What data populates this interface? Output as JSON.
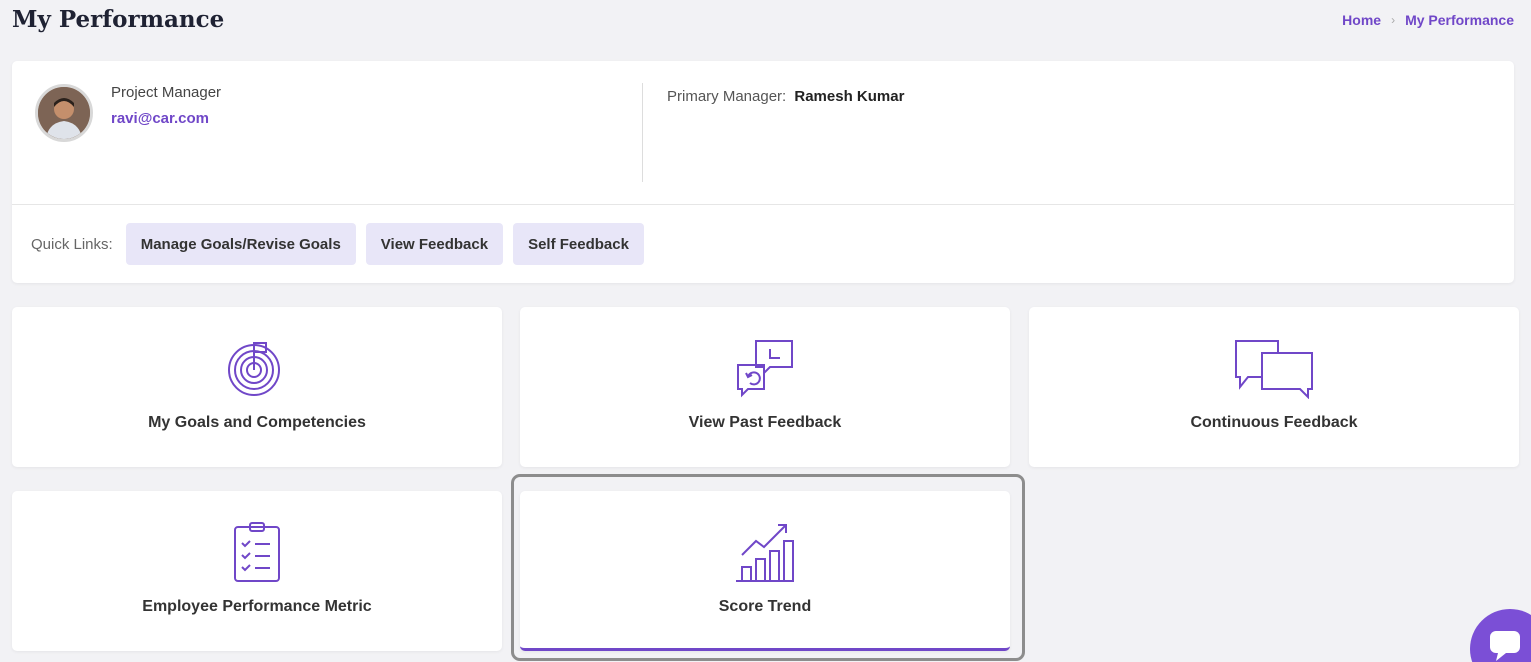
{
  "page": {
    "title": "My Performance",
    "breadcrumb": {
      "home": "Home",
      "current": "My Performance"
    }
  },
  "profile": {
    "role": "Project Manager",
    "email": "ravi@car.com",
    "primary_manager_label": "Primary Manager:",
    "primary_manager_name": "Ramesh Kumar"
  },
  "quick_links": {
    "label": "Quick Links:",
    "items": [
      "Manage Goals/Revise Goals",
      "View Feedback",
      "Self Feedback"
    ]
  },
  "tiles": [
    {
      "label": "My Goals and Competencies",
      "icon": "target-icon"
    },
    {
      "label": "View Past Feedback",
      "icon": "past-feedback-icon"
    },
    {
      "label": "Continuous Feedback",
      "icon": "chat-bubbles-icon"
    },
    {
      "label": "Employee Performance Metric",
      "icon": "clipboard-checklist-icon"
    },
    {
      "label": "Score Trend",
      "icon": "trend-chart-icon",
      "selected": true
    }
  ],
  "colors": {
    "accent": "#7047c8",
    "chip_bg": "#e8e6f8",
    "page_bg": "#f2f2f5"
  }
}
